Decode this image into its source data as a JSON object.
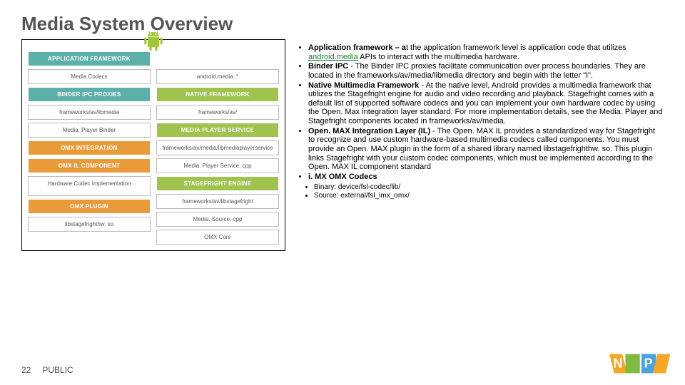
{
  "title": "Media System Overview",
  "diagram": {
    "left": {
      "appfw": "APPLICATION FRAMEWORK",
      "codecs": "Media Codecs",
      "ipc": "BINDER IPC PROXIES",
      "libmedia": "frameworks/av/libmedia",
      "player_binder": "Media. Player Binder",
      "omx_int": "OMX INTEGRATION",
      "omx_il": "OMX IL COMPONENT",
      "hw_codec": "Hardware Codec Implementation",
      "omx_plugin": "OMX PLUGIN",
      "libstage": "libstagefrighthw. so"
    },
    "right": {
      "appfw_blank": "",
      "android_media": "android.media. *",
      "native_fw": "NATIVE FRAMEWORK",
      "fw_av": "frameworks/av/",
      "mps": "MEDIA PLAYER SERVICE",
      "mps_path": "frameworks/av/media/libmediaplayerservice",
      "mps_cpp": "Media. Player Service. cpp",
      "stage_eng": "STAGEFRIGHT ENGINE",
      "stage_path": "frameworks/av/libstagefright",
      "media_source": "Media. Source. cpp",
      "omx_core": "OMX Core"
    }
  },
  "bullets": {
    "b1_bold": "Application framework – a",
    "b1_rest": "t the application framework level is application code that utilizes ",
    "b1_link": "android.media",
    "b1_tail": " APIs to interact with the multimedia hardware.",
    "b2_bold": "Binder IPC",
    "b2_rest": " - The Binder IPC proxies facilitate communication over process boundaries. They are located in the frameworks/av/media/libmedia directory and begin with the letter \"I\".",
    "b3_bold": "Native Multimedia Framework",
    "b3_rest": " - At the native level, Android provides a multimedia framework that utilizes the Stagefright engine for audio and video recording and playback. Stagefright comes with a default list of supported software codecs and you can implement your own hardware codec by using the Open. Max integration layer standard. For more implementation details, see the Media. Player and Stagefright components located in frameworks/av/media.",
    "b4_bold": "Open. MAX Integration Layer (IL)",
    "b4_rest": " - The Open. MAX IL provides a standardized way for Stagefright to recognize and use custom hardware-based multimedia codecs called components. You must provide an Open. MAX plugin in the form of a shared library named libstagefrighthw. so. This plugin links Stagefright with your custom codec components, which must be implemented according to the Open. MAX IL component standard",
    "b5_bold": "i. MX OMX Codecs",
    "sub1": "Binary: device/fsl-codec/lib/",
    "sub2": "Source: external/fsl_imx_omx/"
  },
  "footer": {
    "page": "22",
    "label": "PUBLIC"
  }
}
